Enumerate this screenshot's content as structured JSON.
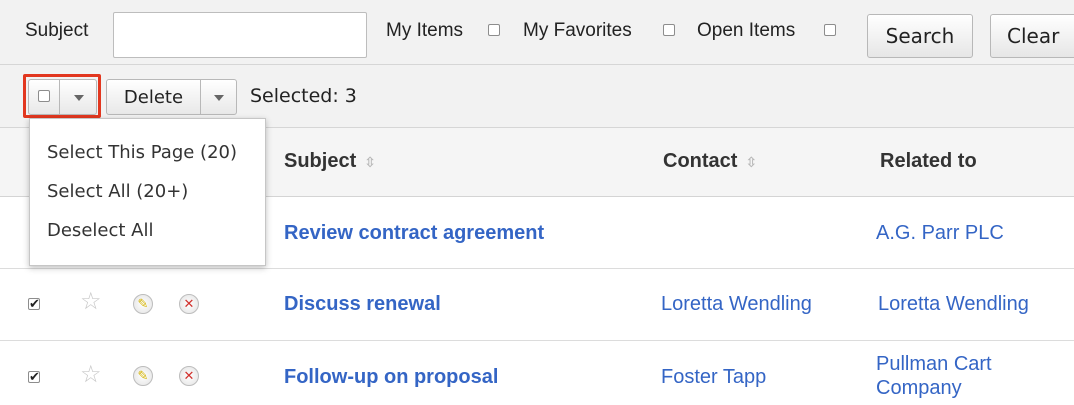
{
  "search": {
    "subject_label": "Subject",
    "subject_value": "",
    "my_items_label": "My Items",
    "my_favorites_label": "My Favorites",
    "open_items_label": "Open Items",
    "search_button": "Search",
    "clear_button": "Clear"
  },
  "actions": {
    "delete_label": "Delete",
    "selected_text": "Selected: 3"
  },
  "mass_menu": {
    "items": [
      {
        "label": "Select This Page (20)"
      },
      {
        "label": "Select All (20+)"
      },
      {
        "label": "Deselect All"
      }
    ]
  },
  "table": {
    "columns": [
      "Subject",
      "Contact",
      "Related to"
    ],
    "rows": [
      {
        "subject": "Review contract agreement",
        "contact": "",
        "related_line1": "A.G. Parr PLC",
        "related_line2": ""
      },
      {
        "subject": "Discuss renewal",
        "contact": "Loretta Wendling",
        "related_line1": "Loretta Wendling",
        "related_line2": ""
      },
      {
        "subject": "Follow-up on proposal",
        "contact": "Foster Tapp",
        "related_line1": "Pullman Cart",
        "related_line2": "Company"
      }
    ]
  },
  "colors": {
    "link": "#3465c5",
    "highlight_box": "#e2371f"
  },
  "icons": [
    "checkbox",
    "chevron-down-icon",
    "star-icon",
    "edit-icon",
    "delete-icon",
    "sort-icon"
  ]
}
